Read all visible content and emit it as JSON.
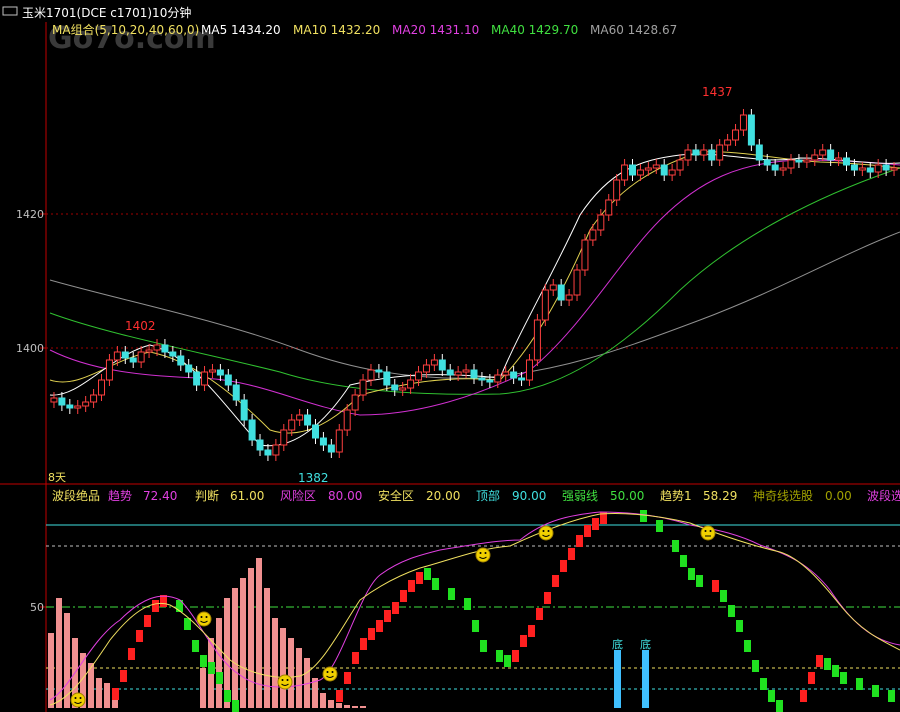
{
  "title": {
    "icon": "window-icon",
    "text": "玉米1701(DCE c1701)10分钟"
  },
  "watermark": "Go7o.com",
  "main_panel": {
    "ma_group_label": "MA组合(5,10,20,40,60,0)",
    "ma_values": [
      {
        "label": "MA5 1434.20",
        "color": "#ffffff"
      },
      {
        "label": "MA10 1432.20",
        "color": "#f0e060"
      },
      {
        "label": "MA20 1431.10",
        "color": "#e040e0"
      },
      {
        "label": "MA40 1429.70",
        "color": "#40e040"
      },
      {
        "label": "MA60 1428.67",
        "color": "#a0a0a0"
      }
    ],
    "y_ticks": [
      "1420",
      "1400"
    ],
    "annotations": {
      "high_left": "1402",
      "low": "1382",
      "high_right": "1437"
    },
    "bottom_note": "8天"
  },
  "indicator_panel": {
    "title": "波段绝品",
    "values": [
      {
        "label": "趋势",
        "value": "72.40",
        "color": "#e040e0"
      },
      {
        "label": "判断",
        "value": "61.00",
        "color": "#f0e060"
      },
      {
        "label": "风险区",
        "value": "80.00",
        "color": "#e040e0"
      },
      {
        "label": "安全区",
        "value": "20.00",
        "color": "#f0e060"
      },
      {
        "label": "顶部",
        "value": "90.00",
        "color": "#40e0e0"
      },
      {
        "label": "强弱线",
        "value": "50.00",
        "color": "#40e040"
      },
      {
        "label": "趋势1",
        "value": "58.29",
        "color": "#f0e060"
      },
      {
        "label": "神奇线选股",
        "value": "0.00",
        "color": "#a0a000"
      },
      {
        "label": "波段选",
        "value": "",
        "color": "#e040e0"
      }
    ],
    "y_tick": "50",
    "marker_label": "底"
  },
  "colors": {
    "up_candle": "#ff4040",
    "down_candle": "#40e0e0",
    "grid_red": "#a00000",
    "axis_red": "#c00000",
    "text_red": "#ff3030"
  }
}
